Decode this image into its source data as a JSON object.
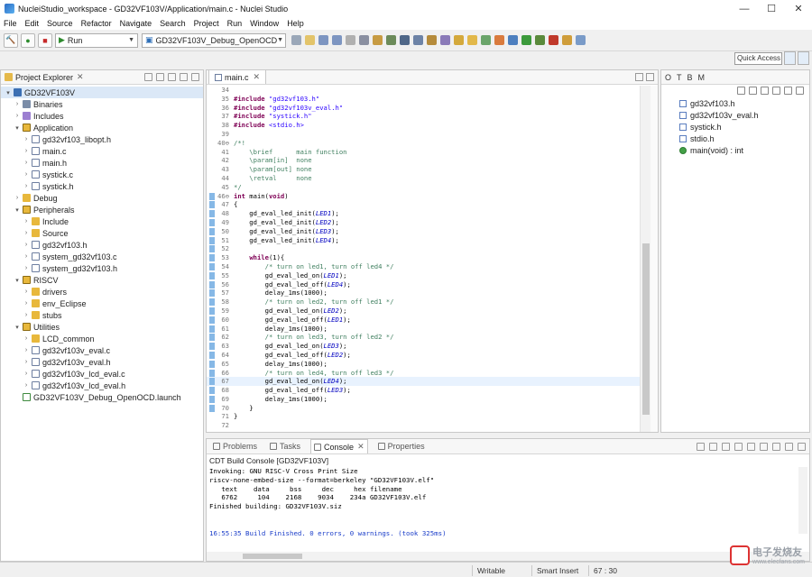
{
  "window": {
    "title": "NucleiStudio_workspace - GD32VF103V/Application/main.c - Nuclei Studio",
    "controls": [
      "—",
      "☐",
      "✕"
    ]
  },
  "menu": [
    "File",
    "Edit",
    "Source",
    "Refactor",
    "Navigate",
    "Search",
    "Project",
    "Run",
    "Window",
    "Help"
  ],
  "toolbar": {
    "run_mode": "Run",
    "launch_config": "GD32VF103V_Debug_OpenOCD",
    "quick_access_placeholder": "Quick Access"
  },
  "project_explorer": {
    "tab_label": "Project Explorer",
    "close": "✕",
    "items": [
      {
        "label": "GD32VF103V",
        "indent": 0,
        "twisty": "▾",
        "icon": "proj",
        "selected": true
      },
      {
        "label": "Binaries",
        "indent": 1,
        "twisty": "›",
        "icon": "bin"
      },
      {
        "label": "Includes",
        "indent": 1,
        "twisty": "›",
        "icon": "inc"
      },
      {
        "label": "Application",
        "indent": 1,
        "twisty": "▾",
        "icon": "srcf"
      },
      {
        "label": "gd32vf103_libopt.h",
        "indent": 2,
        "twisty": "›",
        "icon": "file"
      },
      {
        "label": "main.c",
        "indent": 2,
        "twisty": "›",
        "icon": "file"
      },
      {
        "label": "main.h",
        "indent": 2,
        "twisty": "›",
        "icon": "file"
      },
      {
        "label": "systick.c",
        "indent": 2,
        "twisty": "›",
        "icon": "file"
      },
      {
        "label": "systick.h",
        "indent": 2,
        "twisty": "›",
        "icon": "file"
      },
      {
        "label": "Debug",
        "indent": 1,
        "twisty": "›",
        "icon": "folder"
      },
      {
        "label": "Peripherals",
        "indent": 1,
        "twisty": "▾",
        "icon": "srcf"
      },
      {
        "label": "Include",
        "indent": 2,
        "twisty": "›",
        "icon": "folder"
      },
      {
        "label": "Source",
        "indent": 2,
        "twisty": "›",
        "icon": "folder"
      },
      {
        "label": "gd32vf103.h",
        "indent": 2,
        "twisty": "›",
        "icon": "file"
      },
      {
        "label": "system_gd32vf103.c",
        "indent": 2,
        "twisty": "›",
        "icon": "file"
      },
      {
        "label": "system_gd32vf103.h",
        "indent": 2,
        "twisty": "›",
        "icon": "file"
      },
      {
        "label": "RISCV",
        "indent": 1,
        "twisty": "▾",
        "icon": "srcf"
      },
      {
        "label": "drivers",
        "indent": 2,
        "twisty": "›",
        "icon": "folder"
      },
      {
        "label": "env_Eclipse",
        "indent": 2,
        "twisty": "›",
        "icon": "folder"
      },
      {
        "label": "stubs",
        "indent": 2,
        "twisty": "›",
        "icon": "folder"
      },
      {
        "label": "Utilities",
        "indent": 1,
        "twisty": "▾",
        "icon": "srcf"
      },
      {
        "label": "LCD_common",
        "indent": 2,
        "twisty": "›",
        "icon": "folder"
      },
      {
        "label": "gd32vf103v_eval.c",
        "indent": 2,
        "twisty": "›",
        "icon": "file"
      },
      {
        "label": "gd32vf103v_eval.h",
        "indent": 2,
        "twisty": "›",
        "icon": "file"
      },
      {
        "label": "gd32vf103v_lcd_eval.c",
        "indent": 2,
        "twisty": "›",
        "icon": "file"
      },
      {
        "label": "gd32vf103v_lcd_eval.h",
        "indent": 2,
        "twisty": "›",
        "icon": "file"
      },
      {
        "label": "GD32VF103V_Debug_OpenOCD.launch",
        "indent": 1,
        "twisty": "",
        "icon": "launch"
      }
    ]
  },
  "editor": {
    "tab_label": "main.c",
    "close": "✕",
    "lines": [
      {
        "n": "34",
        "html": ""
      },
      {
        "n": "35",
        "html": "<span class='kw'>#include</span> <span class='str'>\"gd32vf103.h\"</span>"
      },
      {
        "n": "36",
        "html": "<span class='kw'>#include</span> <span class='str'>\"gd32vf103v_eval.h\"</span>"
      },
      {
        "n": "37",
        "html": "<span class='kw'>#include</span> <span class='str'>\"systick.h\"</span>"
      },
      {
        "n": "38",
        "html": "<span class='kw'>#include</span> <span class='str'>&lt;stdio.h&gt;</span>"
      },
      {
        "n": "39",
        "html": ""
      },
      {
        "n": "40⊖",
        "html": "<span class='cm'>/*!</span>"
      },
      {
        "n": "41",
        "html": "<span class='cm'>    \\brief      main function</span>"
      },
      {
        "n": "42",
        "html": "<span class='cm'>    \\param[in]  none</span>"
      },
      {
        "n": "43",
        "html": "<span class='cm'>    \\param[out] none</span>"
      },
      {
        "n": "44",
        "html": "<span class='cm'>    \\retval     none</span>"
      },
      {
        "n": "45",
        "html": "<span class='cm'>*/</span>"
      },
      {
        "n": "46⊖",
        "html": "<span class='kw'>int</span> main(<span class='kw'>void</span>)",
        "mark": true
      },
      {
        "n": "47",
        "html": "{",
        "mark": true
      },
      {
        "n": "48",
        "html": "    gd_eval_led_init(<span class='it'>LED1</span>);",
        "mark": true
      },
      {
        "n": "49",
        "html": "    gd_eval_led_init(<span class='it'>LED2</span>);",
        "mark": true
      },
      {
        "n": "50",
        "html": "    gd_eval_led_init(<span class='it'>LED3</span>);",
        "mark": true
      },
      {
        "n": "51",
        "html": "    gd_eval_led_init(<span class='it'>LED4</span>);",
        "mark": true
      },
      {
        "n": "52",
        "html": "",
        "mark": true
      },
      {
        "n": "53",
        "html": "    <span class='kw'>while</span>(1){",
        "mark": true
      },
      {
        "n": "54",
        "html": "        <span class='cm'>/* turn on led1, turn off led4 */</span>",
        "mark": true
      },
      {
        "n": "55",
        "html": "        gd_eval_led_on(<span class='it'>LED1</span>);",
        "mark": true
      },
      {
        "n": "56",
        "html": "        gd_eval_led_off(<span class='it'>LED4</span>);",
        "mark": true
      },
      {
        "n": "57",
        "html": "        delay_1ms(1000);",
        "mark": true
      },
      {
        "n": "58",
        "html": "        <span class='cm'>/* turn on led2, turn off led1 */</span>",
        "mark": true
      },
      {
        "n": "59",
        "html": "        gd_eval_led_on(<span class='it'>LED2</span>);",
        "mark": true
      },
      {
        "n": "60",
        "html": "        gd_eval_led_off(<span class='it'>LED1</span>);",
        "mark": true
      },
      {
        "n": "61",
        "html": "        delay_1ms(1000);",
        "mark": true
      },
      {
        "n": "62",
        "html": "        <span class='cm'>/* turn on led3, turn off led2 */</span>",
        "mark": true
      },
      {
        "n": "63",
        "html": "        gd_eval_led_on(<span class='it'>LED3</span>);",
        "mark": true
      },
      {
        "n": "64",
        "html": "        gd_eval_led_off(<span class='it'>LED2</span>);",
        "mark": true
      },
      {
        "n": "65",
        "html": "        delay_1ms(1000);",
        "mark": true
      },
      {
        "n": "66",
        "html": "        <span class='cm'>/* turn on led4, turn off led3 */</span>",
        "mark": true
      },
      {
        "n": "67",
        "html": "        gd_eval_led_on(<span class='it'>LED4</span>);",
        "mark": true,
        "current": true
      },
      {
        "n": "68",
        "html": "        gd_eval_led_off(<span class='it'>LED3</span>);",
        "mark": true
      },
      {
        "n": "69",
        "html": "        delay_1ms(1000);",
        "mark": true
      },
      {
        "n": "70",
        "html": "    }",
        "mark": true
      },
      {
        "n": "71",
        "html": "}"
      },
      {
        "n": "72",
        "html": ""
      }
    ]
  },
  "outline": {
    "tabs": [
      "O",
      "T",
      "B",
      "M"
    ],
    "items": [
      {
        "label": "gd32vf103.h",
        "kind": "include"
      },
      {
        "label": "gd32vf103v_eval.h",
        "kind": "include"
      },
      {
        "label": "systick.h",
        "kind": "include"
      },
      {
        "label": "stdio.h",
        "kind": "include"
      },
      {
        "label": "main(void) : int",
        "kind": "function"
      }
    ]
  },
  "console": {
    "tabs": [
      {
        "label": "Problems",
        "active": false
      },
      {
        "label": "Tasks",
        "active": false
      },
      {
        "label": "Console",
        "active": true
      },
      {
        "label": "Properties",
        "active": false
      }
    ],
    "close": "✕",
    "title": "CDT Build Console [GD32VF103V]",
    "lines": [
      {
        "text": "Invoking: GNU RISC-V Cross Print Size",
        "cls": ""
      },
      {
        "text": "riscv-none-embed-size --format=berkeley \"GD32VF103V.elf\"",
        "cls": ""
      },
      {
        "text": "   text    data     bss     dec     hex filename",
        "cls": ""
      },
      {
        "text": "   6762     104    2168    9034    234a GD32VF103V.elf",
        "cls": ""
      },
      {
        "text": "Finished building: GD32VF103V.siz",
        "cls": ""
      },
      {
        "text": "",
        "cls": ""
      },
      {
        "text": "",
        "cls": ""
      },
      {
        "text": "16:55:35 Build Finished. 0 errors, 0 warnings. (took 325ms)",
        "cls": "blue"
      }
    ]
  },
  "statusbar": {
    "writable": "Writable",
    "insert_mode": "Smart Insert",
    "position": "67 : 30"
  },
  "watermark": {
    "text": "电子发烧友",
    "url": "www.elecfans.com"
  }
}
